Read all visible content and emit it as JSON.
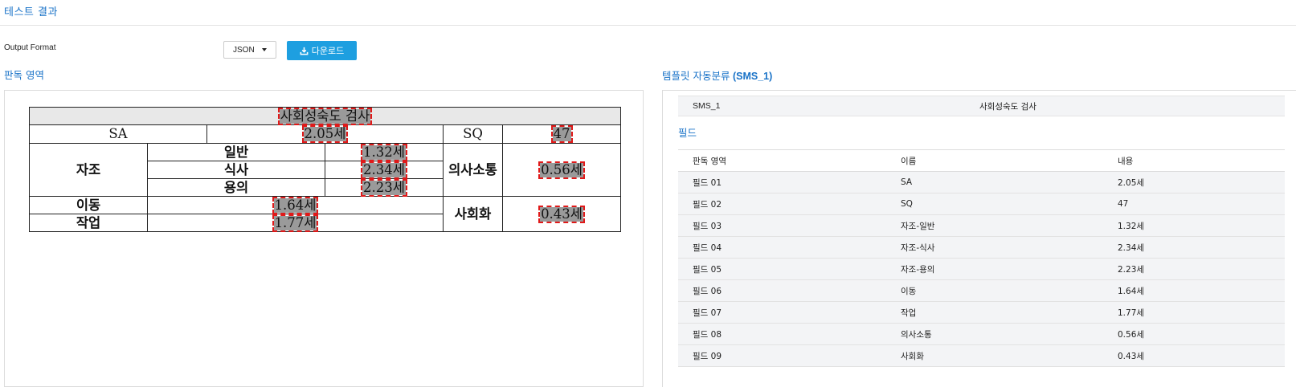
{
  "page_title": "테스트 결과",
  "output": {
    "label": "Output Format",
    "format_value": "JSON",
    "download_label": "다운로드"
  },
  "left_section": {
    "title": "판독 영역",
    "document": {
      "title": "사회성숙도 검사",
      "sa_label": "SA",
      "sa_value": "2.05세",
      "sq_label": "SQ",
      "sq_value": "47",
      "self_help": "자조",
      "general": "일반",
      "general_value": "1.32세",
      "eating": "식사",
      "eating_value": "2.34세",
      "dressing": "용의",
      "dressing_value": "2.23세",
      "communication": "의사소통",
      "communication_value": "0.56세",
      "locomotion": "이동",
      "locomotion_value": "1.64세",
      "occupation": "작업",
      "occupation_value": "1.77세",
      "socialization": "사회화",
      "socialization_value": "0.43세"
    }
  },
  "right_section": {
    "title_ko": "템플릿 자동분류",
    "title_code": "(SMS_1)",
    "template_code": "SMS_1",
    "template_name": "사회성숙도 검사",
    "fields_title": "필드",
    "columns": [
      "판독 영역",
      "이름",
      "내용"
    ],
    "rows": [
      [
        "필드 01",
        "SA",
        "2.05세"
      ],
      [
        "필드 02",
        "SQ",
        "47"
      ],
      [
        "필드 03",
        "자조-일반",
        "1.32세"
      ],
      [
        "필드 04",
        "자조-식사",
        "2.34세"
      ],
      [
        "필드 05",
        "자조-용의",
        "2.23세"
      ],
      [
        "필드 06",
        "이동",
        "1.64세"
      ],
      [
        "필드 07",
        "작업",
        "1.77세"
      ],
      [
        "필드 08",
        "의사소통",
        "0.56세"
      ],
      [
        "필드 09",
        "사회화",
        "0.43세"
      ]
    ]
  },
  "icons": {
    "download": "download-icon",
    "caret": "caret-down-icon"
  },
  "colors": {
    "accent": "#1a73c8",
    "button": "#1e9fe0",
    "highlight_border": "#e01919"
  }
}
